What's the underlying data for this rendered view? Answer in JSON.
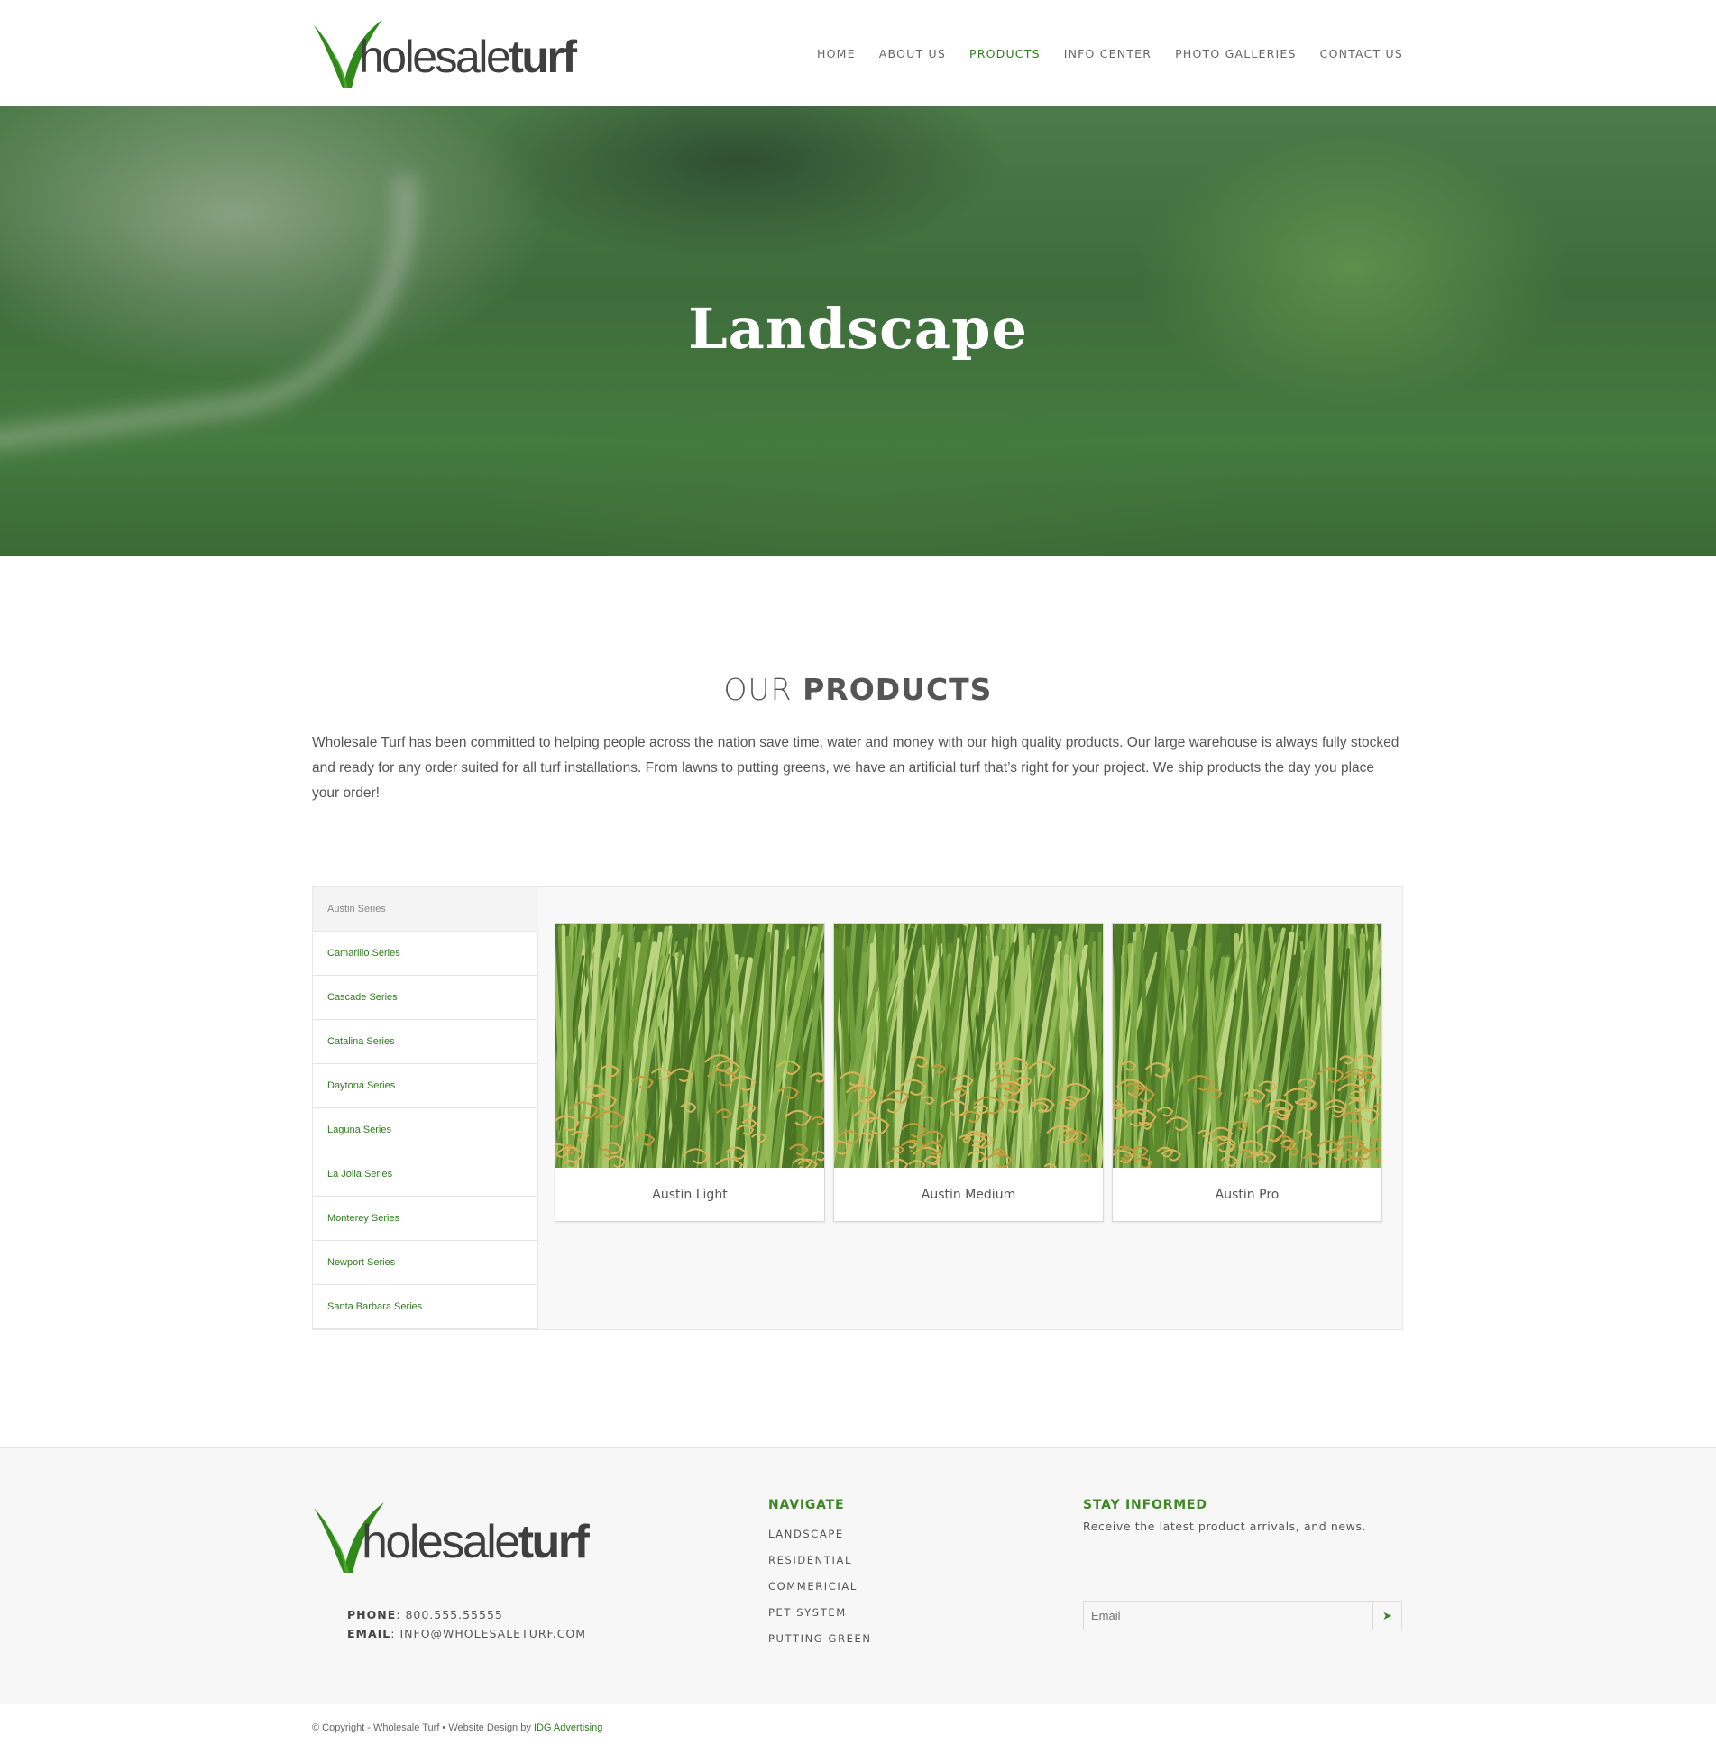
{
  "brand": {
    "logo_light": "holesale",
    "logo_bold": "turf",
    "logo_initial": "W"
  },
  "nav": [
    {
      "label": "HOME",
      "active": false
    },
    {
      "label": "ABOUT US",
      "active": false
    },
    {
      "label": "PRODUCTS",
      "active": true
    },
    {
      "label": "INFO CENTER",
      "active": false
    },
    {
      "label": "PHOTO GALLERIES",
      "active": false
    },
    {
      "label": "CONTACT US",
      "active": false
    }
  ],
  "hero": {
    "title": "Landscape"
  },
  "products": {
    "title_light": "OUR ",
    "title_bold": "PRODUCTS",
    "intro": "Wholesale Turf has been committed to helping people across the nation save time, water and money with our high quality products. Our large warehouse is always fully stocked and ready for any order suited for all turf installations. From lawns to putting greens, we have an artificial turf that’s right for your project. We ship products the day you place your order!",
    "series": [
      "Austin Series",
      "Camarillo Series",
      "Cascade Series",
      "Catalina Series",
      "Daytona Series",
      "Laguna Series",
      "La Jolla Series",
      "Monterey Series",
      "Newport Series",
      "Santa Barbara Series"
    ],
    "cards": [
      {
        "label": "Austin Light"
      },
      {
        "label": "Austin Medium"
      },
      {
        "label": "Austin Pro"
      }
    ]
  },
  "footer": {
    "phone_label": "PHONE",
    "phone": "800.555.55555",
    "email_label": "EMAIL",
    "email": "INFO@WHOLESALETURF.COM",
    "navigate_heading": "NAVIGATE",
    "navigate_links": [
      "LANDSCAPE",
      "RESIDENTIAL",
      "COMMERICIAL",
      "PET SYSTEM",
      "PUTTING GREEN"
    ],
    "stay_heading": "STAY INFORMED",
    "stay_sub": "Receive the latest product arrivals, and news.",
    "email_placeholder": "Email"
  },
  "copyright": {
    "text": "© Copyright - Wholesale Turf • Website Design by ",
    "link": "IDG Advertising"
  },
  "colors": {
    "accent": "#2f7d1e",
    "logo_green": "#3b9a1d",
    "text": "#555555"
  }
}
